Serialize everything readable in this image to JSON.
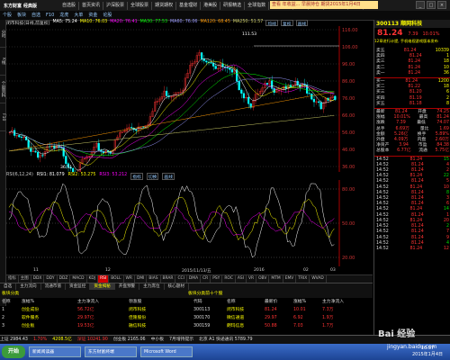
{
  "app": {
    "logo": "东方财富",
    "logo_sub": "经典版",
    "menu": [
      "自选股",
      "首页资讯",
      "沪深股票",
      "全球股票",
      "期货期权",
      "基金理财",
      "港美股",
      "研报精选",
      "全球指数",
      "资金监控",
      "资讯",
      "公告",
      "个股论坛",
      "设置"
    ],
    "ad_text": "查看 年收益... 早晨持仓 期货2015年1月4日",
    "window_buttons": [
      "_",
      "□",
      "×"
    ],
    "toolbar": [
      "个股",
      "板块",
      "自选",
      "F10",
      "龙虎",
      "大单",
      "资金",
      "论股"
    ]
  },
  "left_tabs": [
    "分时",
    "K线",
    "个股资料",
    "F10"
  ],
  "chart_header": {
    "title": "闭市科技(日线,前复权)",
    "ma": [
      {
        "label": "MA5: 75.24",
        "color": "#ffffff"
      },
      {
        "label": "MA10: 76.03",
        "color": "#ffff00"
      },
      {
        "label": "MA20: 76.41",
        "color": "#ff00ff"
      },
      {
        "label": "MA30: 77.53",
        "color": "#00ff00"
      },
      {
        "label": "MA60: 76.06",
        "color": "#9999ff"
      },
      {
        "label": "MA120: 68.45",
        "color": "#ff9900"
      },
      {
        "label": "MA250: 51.57",
        "color": "#cccc66"
      }
    ],
    "buttons": [
      "均线",
      "复权",
      "画线"
    ]
  },
  "main_chart": {
    "price_labels": [
      "116.00",
      "106.00",
      "96.00",
      "86.00",
      "76.00",
      "66.00",
      "56.00",
      "46.00",
      "36.00"
    ],
    "highest": "111.53",
    "lowest": "36.51"
  },
  "sub_header": {
    "labels": [
      {
        "text": "RSI(6,12,24)",
        "color": "#cccccc"
      },
      {
        "text": "RSI1: 81.079",
        "color": "#ffffff"
      },
      {
        "text": "RSI2: 53.275",
        "color": "#ffff00"
      },
      {
        "text": "RSI3: 53.212",
        "color": "#ff00ff"
      }
    ],
    "buttons": [
      "指标",
      "切换",
      "画线"
    ]
  },
  "osc_chart": {
    "labels": [
      "80.00",
      "50.00",
      "20.00"
    ]
  },
  "date_axis": [
    "11",
    "12",
    "2015/11/13/五",
    "2016",
    "02",
    "03"
  ],
  "indicator_tabs": [
    "指标",
    "主图",
    "DDX",
    "DDY",
    "DDZ",
    "MACD",
    "KDJ",
    "RSI",
    "BOLL",
    "WR",
    "DMI",
    "BIAS",
    "BRAR",
    "CCI",
    "DMA",
    "CR",
    "PSY",
    "ROC",
    "ASI",
    "VR",
    "OBV",
    "MTM",
    "EMV",
    "TRIX",
    "WVAD"
  ],
  "bottom_tabs": [
    "自选",
    "主力流向",
    "流通市值",
    "资金监控",
    "资金揭秘",
    "开盘预警",
    "主力席位",
    "核心题材"
  ],
  "bottom_table": {
    "title_left": "板块分类",
    "title_right": "板块分类前十个股",
    "headers_left": [
      "名称",
      "涨幅%",
      "主力净流入",
      "领涨股"
    ],
    "headers_right": [
      "代码",
      "名称",
      "最新价",
      "涨幅%",
      "主力净流入"
    ],
    "rows_left": [
      [
        "1",
        "创业成份",
        "56.72亿",
        "闭市科技"
      ],
      [
        "2",
        "软件服务",
        "29.97亿",
        "佳隆股份"
      ],
      [
        "3",
        "创业板",
        "19.53亿",
        "融信科技"
      ]
    ],
    "rows_right": [
      [
        "300113",
        "闭市科技",
        "81.24",
        "10.01",
        "7.3万"
      ],
      [
        "300170",
        "微信通道",
        "29.97",
        "6.92",
        "1.9万"
      ],
      [
        "300159",
        "朗玛信息",
        "50.88",
        "7.03",
        "1.7万"
      ]
    ]
  },
  "status_bar": [
    "上证 2984.43",
    "1.70%",
    "4208.5亿",
    "深证 10241.90",
    "创业板 2165.06",
    "中小板",
    "7月增持提示",
    "北京 A1 快递通讯 5789.79"
  ],
  "right_panel": {
    "code_name": "300113 顺网科技",
    "price": "81.24",
    "change": "7.39",
    "change_pct": "10.01%",
    "note": "12章进行计提, 手机电视游戏版本发布",
    "sell": [
      [
        "卖五",
        "81.24",
        "10339"
      ],
      [
        "卖四",
        "81.24",
        "1"
      ],
      [
        "卖三",
        "81.24",
        "18"
      ],
      [
        "卖二",
        "81.24",
        "10"
      ],
      [
        "卖一",
        "81.24",
        "36"
      ]
    ],
    "buy": [
      [
        "买一",
        "81.24",
        "1200"
      ],
      [
        "买二",
        "81.22",
        "18"
      ],
      [
        "买三",
        "81.20",
        "6"
      ],
      [
        "买四",
        "81.19",
        "2"
      ],
      [
        "买五",
        "81.18",
        "8"
      ]
    ],
    "stats": [
      [
        "最新",
        "81.24",
        "开盘",
        "74.25"
      ],
      [
        "涨幅",
        "10.01%",
        "最高",
        "81.24"
      ],
      [
        "涨跌",
        "7.39",
        "最低",
        "74.07"
      ],
      [
        "总手",
        "6.69万",
        "量比",
        "1.69"
      ],
      [
        "金额",
        "5.26亿",
        "换手",
        "5.89%"
      ],
      [
        "外盘",
        "4.09万",
        "内盘",
        "2.60万"
      ],
      [
        "净资产",
        "3.94",
        "市盈",
        "84.38"
      ],
      [
        "总股本",
        "6.77亿",
        "流通",
        "5.75亿"
      ]
    ],
    "ticks": [
      [
        "14:52",
        "81.24",
        "15"
      ],
      [
        "14:52",
        "81.24",
        "4"
      ],
      [
        "14:52",
        "81.24",
        "2"
      ],
      [
        "14:52",
        "81.24",
        "22"
      ],
      [
        "14:52",
        "81.24",
        "5"
      ],
      [
        "14:52",
        "81.24",
        "10"
      ],
      [
        "14:52",
        "81.24",
        "8"
      ],
      [
        "14:52",
        "81.24",
        "3"
      ],
      [
        "14:52",
        "81.24",
        "6"
      ],
      [
        "14:52",
        "81.24",
        "14"
      ],
      [
        "14:52",
        "81.24",
        "1"
      ],
      [
        "14:52",
        "81.24",
        "20"
      ],
      [
        "14:52",
        "81.24",
        "2"
      ],
      [
        "14:52",
        "81.24",
        "7"
      ],
      [
        "14:52",
        "81.24",
        "9"
      ],
      [
        "14:52",
        "81.24",
        "4"
      ],
      [
        "14:52",
        "81.24",
        "12"
      ]
    ]
  },
  "taskbar": {
    "start": "开始",
    "tasks": [
      "新闻阅读器",
      "东方财富终端",
      "Microsoft Word"
    ],
    "clock_time": "16:57",
    "clock_date": "2015年1月4日"
  },
  "watermark": "Bai 经验",
  "watermark_sub": "jingyan.baidu.com"
}
